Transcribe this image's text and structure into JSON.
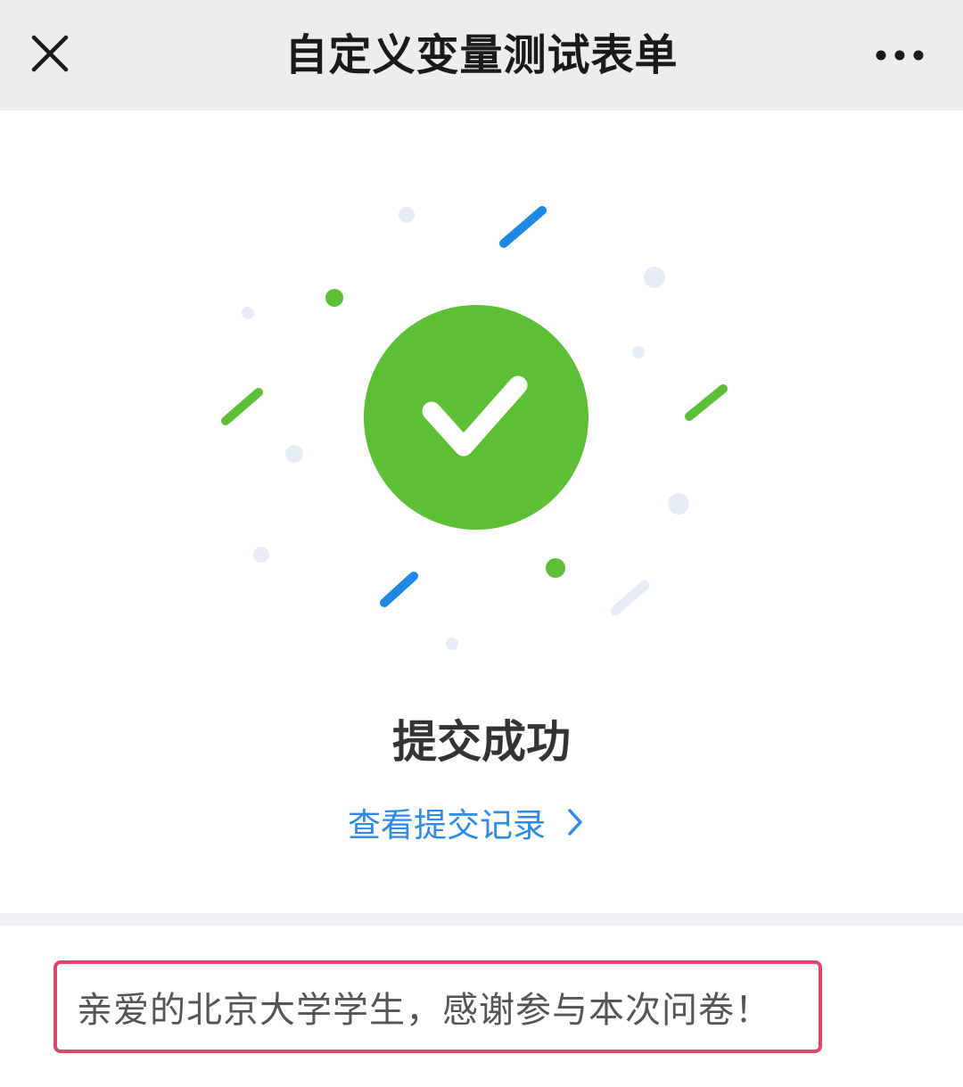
{
  "header": {
    "title": "自定义变量测试表单",
    "close_icon": "close-icon",
    "more_icon": "more-icon"
  },
  "success": {
    "icon": "check-icon",
    "title": "提交成功",
    "link_label": "查看提交记录",
    "link_icon": "chevron-right-icon"
  },
  "message": {
    "text": "亲爱的北京大学学生，感谢参与本次问卷！"
  },
  "colors": {
    "success_green": "#5dbf36",
    "accent_blue": "#1e88e5",
    "link_blue": "#2d8ae6",
    "confetti_gray": "#e6edf7",
    "highlight_border": "#e0446b",
    "title_bar": "#ededed"
  }
}
